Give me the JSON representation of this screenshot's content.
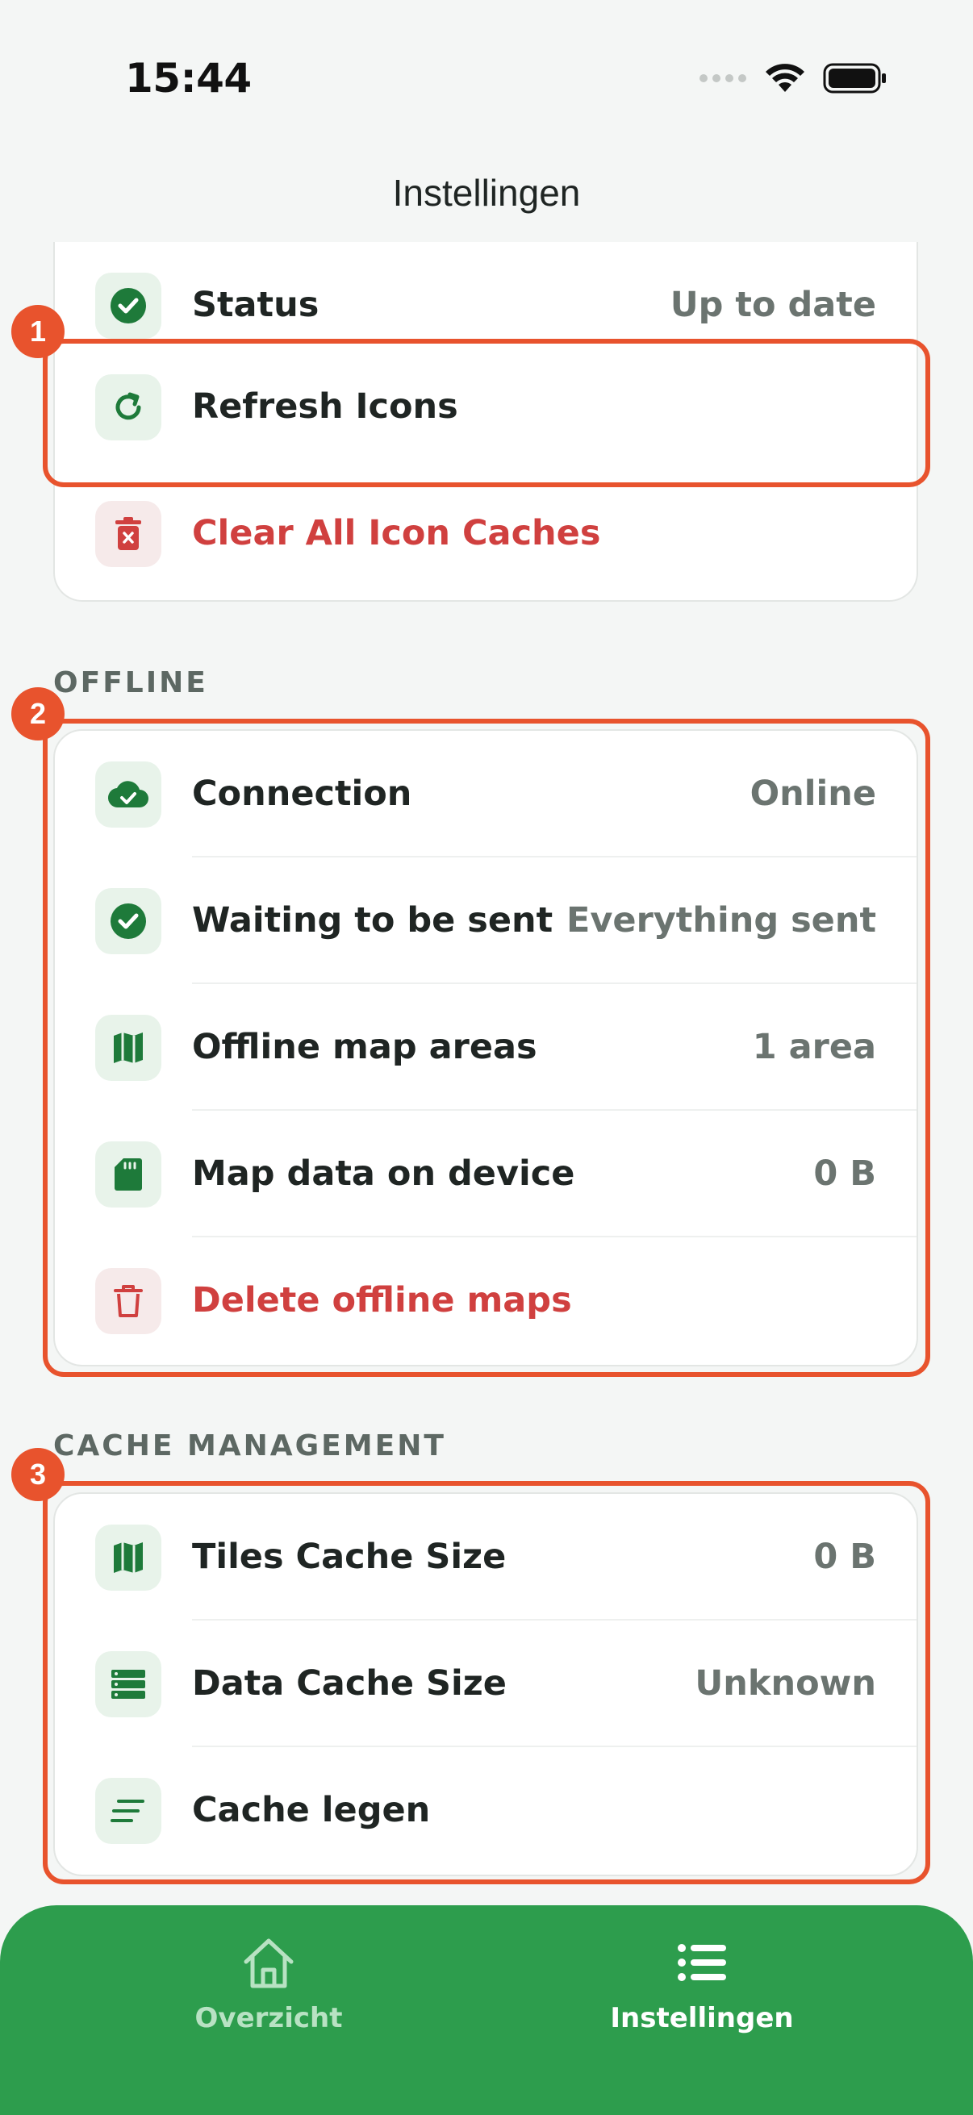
{
  "status_bar": {
    "time": "15:44"
  },
  "nav": {
    "title": "Instellingen"
  },
  "icons_section": {
    "rows": [
      {
        "icon": "check-circle-icon",
        "label": "Status",
        "value": "Up to date"
      },
      {
        "icon": "refresh-icon",
        "label": "Refresh Icons",
        "value": ""
      },
      {
        "icon": "trash-x-icon",
        "label": "Clear All Icon Caches",
        "value": ""
      }
    ]
  },
  "offline_section": {
    "header": "OFFLINE",
    "rows": [
      {
        "icon": "cloud-check-icon",
        "label": "Connection",
        "value": "Online"
      },
      {
        "icon": "check-circle-icon",
        "label": "Waiting to be sent",
        "value": "Everything sent"
      },
      {
        "icon": "map-icon",
        "label": "Offline map areas",
        "value": "1 area"
      },
      {
        "icon": "sd-card-icon",
        "label": "Map data on device",
        "value": "0 B"
      },
      {
        "icon": "trash-icon",
        "label": "Delete offline maps",
        "value": ""
      }
    ]
  },
  "cache_section": {
    "header": "CACHE MANAGEMENT",
    "rows": [
      {
        "icon": "map-icon",
        "label": "Tiles Cache Size",
        "value": "0 B"
      },
      {
        "icon": "storage-icon",
        "label": "Data Cache Size",
        "value": "Unknown"
      },
      {
        "icon": "clear-lines-icon",
        "label": "Cache legen",
        "value": ""
      }
    ]
  },
  "annotations": [
    "1",
    "2",
    "3"
  ],
  "tab_bar": {
    "tabs": [
      {
        "icon": "home-icon",
        "label": "Overzicht"
      },
      {
        "icon": "list-icon",
        "label": "Instellingen"
      }
    ]
  },
  "colors": {
    "accent_green": "#2d9d4d",
    "destructive_red": "#d0403f",
    "annotation_orange": "#e8532d"
  }
}
